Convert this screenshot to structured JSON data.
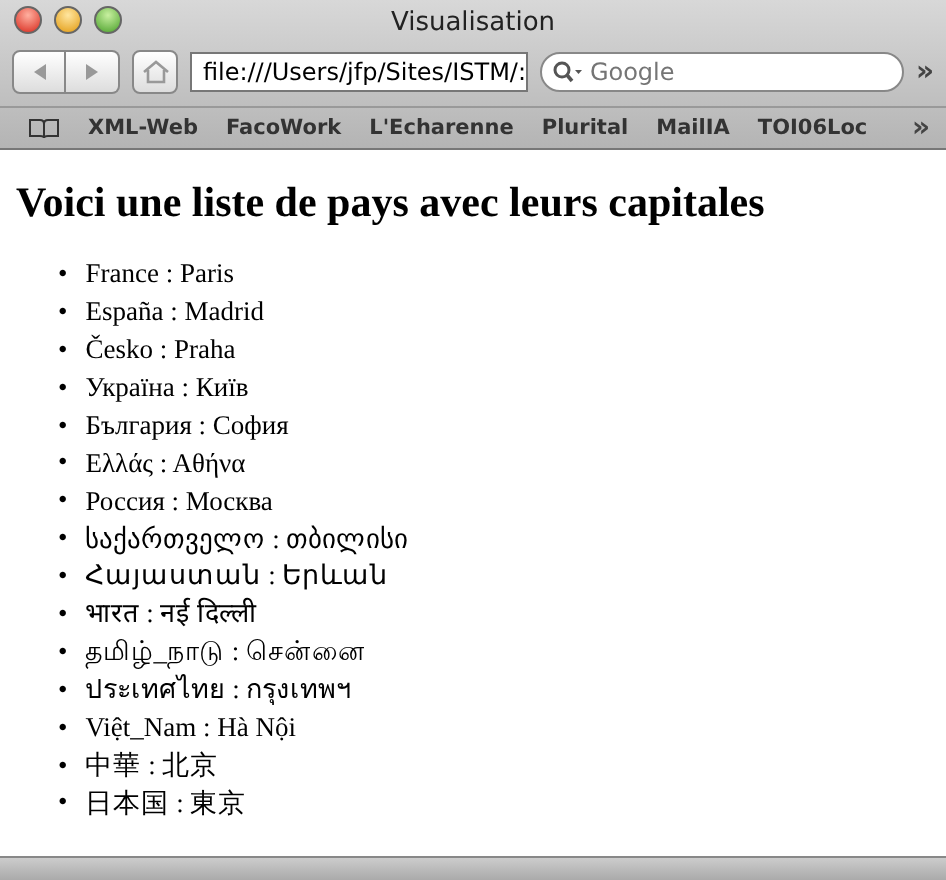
{
  "window": {
    "title": "Visualisation"
  },
  "toolbar": {
    "url": "file:///Users/jfp/Sites/ISTM/:",
    "search": {
      "placeholder": "Google"
    },
    "overflow": "»"
  },
  "bookmarks": {
    "items": [
      "XML-Web",
      "FacoWork",
      "L'Echarenne",
      "Plurital",
      "MailIA",
      "TOI06Loc"
    ],
    "overflow": "»"
  },
  "page": {
    "heading": "Voici une liste de pays avec leurs capitales",
    "items": [
      {
        "bullet": "•",
        "text": "France : Paris"
      },
      {
        "bullet": "•",
        "text": "España : Madrid"
      },
      {
        "bullet": "•",
        "text": "Česko : Praha"
      },
      {
        "bullet": "•",
        "text": "Україна : Київ"
      },
      {
        "bullet": "•",
        "text": "България : София"
      },
      {
        "bullet": "•",
        "text": "Ελλάς : Αθήνα"
      },
      {
        "bullet": "•",
        "text": "Россия : Москва"
      },
      {
        "bullet": "•",
        "text": "საქართველო : თბილისი"
      },
      {
        "bullet": "•",
        "text": "Հայաստան : Երևան"
      },
      {
        "bullet": "•",
        "text": "भारत : नई दिल्ली"
      },
      {
        "bullet": "•",
        "text": "தமிழ்_நாடு : சென்னை"
      },
      {
        "bullet": "•",
        "text": "ประเทศไทย : กรุงเทพฯ"
      },
      {
        "bullet": "•",
        "text": "Việt_Nam : Hà Nội"
      },
      {
        "bullet": "•",
        "text": "中華 : 北京"
      },
      {
        "bullet": "•",
        "text": "日本国 : 東京"
      }
    ]
  }
}
